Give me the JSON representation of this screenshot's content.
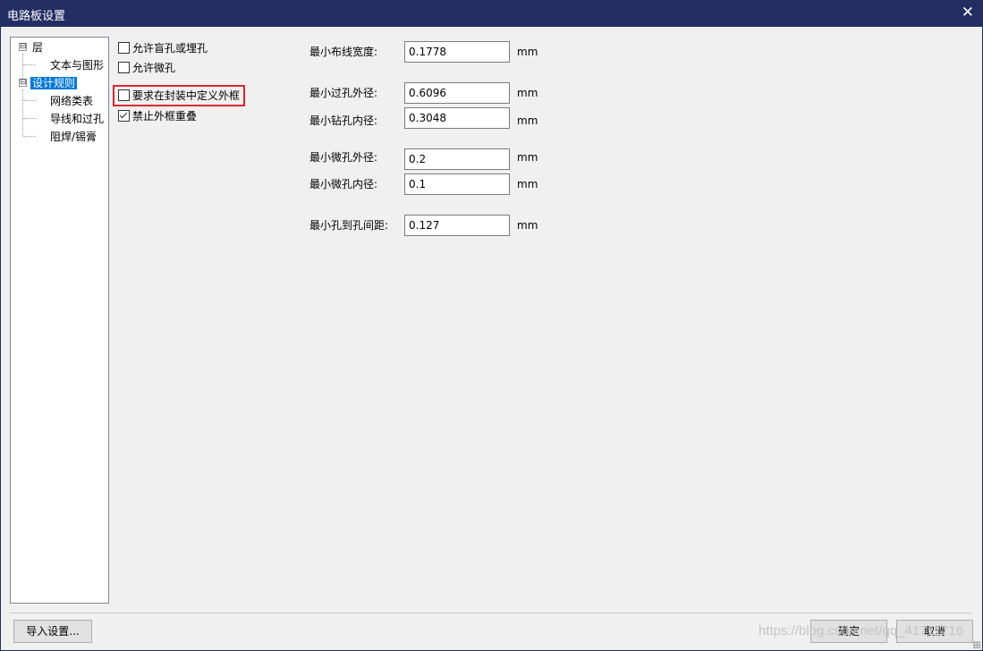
{
  "window": {
    "title": "电路板设置",
    "close_glyph": "✕"
  },
  "tree": {
    "items": [
      {
        "label": "层"
      },
      {
        "label": "文本与图形"
      },
      {
        "label": "设计规则"
      },
      {
        "label": "网络类表"
      },
      {
        "label": "导线和过孔"
      },
      {
        "label": "阻焊/锡膏"
      }
    ],
    "expanders": {
      "collapsed": "⊟"
    }
  },
  "checkboxes": [
    {
      "label": "允许盲孔或埋孔",
      "checked": false
    },
    {
      "label": "允许微孔",
      "checked": false
    },
    {
      "label": "要求在封装中定义外框",
      "checked": false
    },
    {
      "label": "禁止外框重叠",
      "checked": true
    }
  ],
  "fields": [
    {
      "label": "最小布线宽度:",
      "value": "0.1778",
      "unit": "mm"
    },
    {
      "label": "最小过孔外径:",
      "value": "0.6096",
      "unit": "mm"
    },
    {
      "label": "最小钻孔内径:",
      "value": "0.3048",
      "unit": "mm"
    },
    {
      "label": "最小微孔外径:",
      "value": "0.2",
      "unit": "mm"
    },
    {
      "label": "最小微孔内径:",
      "value": "0.1",
      "unit": "mm"
    },
    {
      "label": "最小孔到孔间距:",
      "value": "0.127",
      "unit": "mm"
    }
  ],
  "buttons": {
    "import": "导入设置...",
    "ok": "确定",
    "cancel": "取消"
  },
  "watermark": "https://blog.csdn.net/qq_41711716"
}
